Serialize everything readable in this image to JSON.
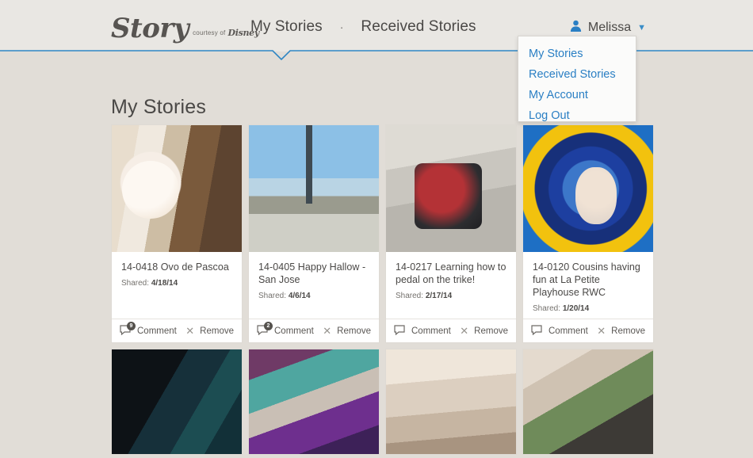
{
  "theme": {
    "page_bg": "#e1ddd7",
    "header_bg": "#e9e7e3",
    "accent_blue": "#2a7fc4",
    "rule_blue": "#2e86c4",
    "card_bg": "#ffffff",
    "text_dark": "#4a4846"
  },
  "header": {
    "logo": {
      "word": "Story",
      "courtesy": "courtesy of",
      "brand": "Disney",
      "icon": "story-logo"
    },
    "nav": {
      "items": [
        {
          "label": "My Stories",
          "active": true
        },
        {
          "label": "Received Stories",
          "active": false
        }
      ],
      "separator": "·"
    },
    "user": {
      "name": "Melissa",
      "avatar_icon": "person-icon",
      "caret_icon": "chevron-down-icon"
    }
  },
  "dropdown": {
    "open": true,
    "items": [
      {
        "label": "My Stories"
      },
      {
        "label": "Received Stories"
      },
      {
        "label": "My Account"
      },
      {
        "label": "Log Out"
      }
    ]
  },
  "main": {
    "page_title": "My Stories",
    "shared_label": "Shared:",
    "comment_label": "Comment",
    "remove_label": "Remove",
    "comment_icon": "speech-bubble-icon",
    "remove_icon": "close-x-icon",
    "cards": [
      {
        "title": "14-0418 Ovo de Pascoa",
        "shared_date": "4/18/14",
        "comment_count": "9",
        "photo": "ph-easter",
        "photo_name": "photo-ovo-de-pascoa"
      },
      {
        "title": "14-0405 Happy Hallow - San Jose",
        "shared_date": "4/6/14",
        "comment_count": "2",
        "photo": "ph-bridge",
        "photo_name": "photo-happy-hallow-san-jose"
      },
      {
        "title": "14-0217 Learning how to pedal on the trike!",
        "shared_date": "2/17/14",
        "comment_count": "",
        "photo": "ph-trike",
        "photo_name": "photo-learning-to-pedal"
      },
      {
        "title": "14-0120 Cousins having fun at La Petite Playhouse RWC",
        "shared_date": "1/20/14",
        "comment_count": "",
        "photo": "ph-tunnel",
        "photo_name": "photo-cousins-playhouse"
      }
    ],
    "cards_row2": [
      {
        "photo": "ph-net",
        "photo_name": "photo-climbing-net"
      },
      {
        "photo": "ph-gym",
        "photo_name": "photo-gym-class"
      },
      {
        "photo": "ph-living",
        "photo_name": "photo-living-room"
      },
      {
        "photo": "ph-bowl",
        "photo_name": "photo-hallway-bowling"
      }
    ]
  }
}
